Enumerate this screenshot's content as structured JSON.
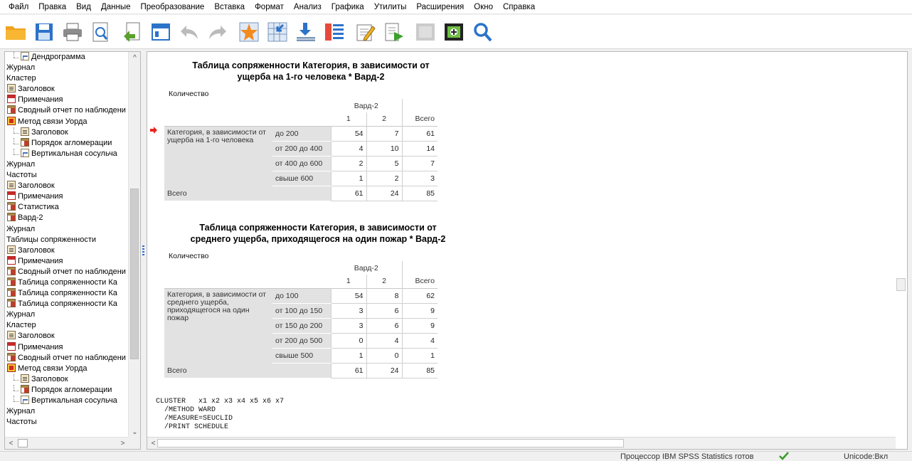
{
  "menu": [
    "Файл",
    "Правка",
    "Вид",
    "Данные",
    "Преобразование",
    "Вставка",
    "Формат",
    "Анализ",
    "Графика",
    "Утилиты",
    "Расширения",
    "Окно",
    "Справка"
  ],
  "toolbar": [
    {
      "name": "open-folder-icon",
      "enabled": true
    },
    {
      "name": "save-icon",
      "enabled": true
    },
    {
      "name": "print-icon",
      "enabled": true
    },
    {
      "name": "print-preview-icon",
      "enabled": true
    },
    {
      "name": "export-icon",
      "enabled": true
    },
    {
      "name": "recall-dialog-icon",
      "enabled": true
    },
    {
      "name": "undo-icon",
      "enabled": false
    },
    {
      "name": "redo-icon",
      "enabled": false
    },
    {
      "name": "goto-case-icon",
      "enabled": true
    },
    {
      "name": "goto-variable-icon",
      "enabled": true
    },
    {
      "name": "insert-output-icon",
      "enabled": true
    },
    {
      "name": "variables-icon",
      "enabled": true
    },
    {
      "name": "edit-icon",
      "enabled": true
    },
    {
      "name": "run-icon",
      "enabled": true
    },
    {
      "name": "hide-icon",
      "enabled": false
    },
    {
      "name": "show-all-icon",
      "enabled": true
    },
    {
      "name": "search-icon",
      "enabled": true
    }
  ],
  "nav_tree": [
    {
      "label": "Дендрограмма",
      "icon": "chart",
      "level": 2
    },
    {
      "label": "Журнал",
      "icon": "",
      "level": 0
    },
    {
      "label": "Кластер",
      "icon": "",
      "level": 0
    },
    {
      "label": "Заголовок",
      "icon": "title",
      "level": 1
    },
    {
      "label": "Примечания",
      "icon": "notes",
      "level": 1
    },
    {
      "label": "Сводный отчет по наблюдени",
      "icon": "table",
      "level": 1
    },
    {
      "label": "Метод связи Уорда",
      "icon": "method",
      "level": 1
    },
    {
      "label": "Заголовок",
      "icon": "title",
      "level": 2
    },
    {
      "label": "Порядок агломерации",
      "icon": "table",
      "level": 2
    },
    {
      "label": "Вертикальная сосульча",
      "icon": "chart",
      "level": 2
    },
    {
      "label": "Журнал",
      "icon": "",
      "level": 0
    },
    {
      "label": "Частоты",
      "icon": "",
      "level": 0
    },
    {
      "label": "Заголовок",
      "icon": "title",
      "level": 1
    },
    {
      "label": "Примечания",
      "icon": "notes",
      "level": 1
    },
    {
      "label": "Статистика",
      "icon": "table",
      "level": 1
    },
    {
      "label": "Вард-2",
      "icon": "table",
      "level": 1
    },
    {
      "label": "Журнал",
      "icon": "",
      "level": 0
    },
    {
      "label": "Таблицы сопряженности",
      "icon": "",
      "level": 0
    },
    {
      "label": "Заголовок",
      "icon": "title",
      "level": 1
    },
    {
      "label": "Примечания",
      "icon": "notes",
      "level": 1
    },
    {
      "label": "Сводный отчет по наблюдени",
      "icon": "table",
      "level": 1
    },
    {
      "label": "Таблица сопряженности Ка",
      "icon": "table",
      "level": 1
    },
    {
      "label": "Таблица сопряженности Ка",
      "icon": "table",
      "level": 1
    },
    {
      "label": "Таблица сопряженности Ка",
      "icon": "table",
      "level": 1
    },
    {
      "label": "Журнал",
      "icon": "",
      "level": 0
    },
    {
      "label": "Кластер",
      "icon": "",
      "level": 0
    },
    {
      "label": "Заголовок",
      "icon": "title",
      "level": 1
    },
    {
      "label": "Примечания",
      "icon": "notes",
      "level": 1
    },
    {
      "label": "Сводный отчет по наблюдени",
      "icon": "table",
      "level": 1
    },
    {
      "label": "Метод связи Уорда",
      "icon": "method",
      "level": 1
    },
    {
      "label": "Заголовок",
      "icon": "title",
      "level": 2
    },
    {
      "label": "Порядок агломерации",
      "icon": "table",
      "level": 2
    },
    {
      "label": "Вертикальная сосульча",
      "icon": "chart",
      "level": 2
    },
    {
      "label": "Журнал",
      "icon": "",
      "level": 0
    },
    {
      "label": "Частоты",
      "icon": "",
      "level": 0
    }
  ],
  "tables": [
    {
      "title_line1": "Таблица сопряженности Категория, в зависимости от",
      "title_line2": "ущерба на 1-го человека * Вард-2",
      "subtitle": "Количество",
      "col_group": "Вард-2",
      "col_headers": [
        "1",
        "2",
        "Всего"
      ],
      "row_label": "Категория, в зависимости от ущерба на 1-го человека",
      "rows": [
        {
          "label": "до 200",
          "values": [
            "54",
            "7",
            "61"
          ]
        },
        {
          "label": "от 200 до 400",
          "values": [
            "4",
            "10",
            "14"
          ]
        },
        {
          "label": "от 400 до 600",
          "values": [
            "2",
            "5",
            "7"
          ]
        },
        {
          "label": "свыше 600",
          "values": [
            "1",
            "2",
            "3"
          ]
        }
      ],
      "total": {
        "label": "Всего",
        "values": [
          "61",
          "24",
          "85"
        ]
      }
    },
    {
      "title_line1": "Таблица сопряженности Категория, в зависимости от",
      "title_line2": "среднего ущерба, приходящегося на один пожар * Вард-2",
      "subtitle": "Количество",
      "col_group": "Вард-2",
      "col_headers": [
        "1",
        "2",
        "Всего"
      ],
      "row_label": "Категория, в зависимости от среднего ущерба, приходящегося на один пожар",
      "rows": [
        {
          "label": "до 100",
          "values": [
            "54",
            "8",
            "62"
          ]
        },
        {
          "label": "от 100 до 150",
          "values": [
            "3",
            "6",
            "9"
          ]
        },
        {
          "label": "от 150 до 200",
          "values": [
            "3",
            "6",
            "9"
          ]
        },
        {
          "label": "от 200 до 500",
          "values": [
            "0",
            "4",
            "4"
          ]
        },
        {
          "label": "свыше 500",
          "values": [
            "1",
            "0",
            "1"
          ]
        }
      ],
      "total": {
        "label": "Всего",
        "values": [
          "61",
          "24",
          "85"
        ]
      }
    }
  ],
  "syntax_lines": [
    "CLUSTER   x1 x2 x3 x4 x5 x6 x7",
    "  /METHOD WARD",
    "  /MEASURE=SEUCLID",
    "  /PRINT SCHEDULE"
  ],
  "status": {
    "processor": "Процессор IBM SPSS Statistics  готов",
    "encoding": "Unicode:Вкл"
  },
  "colors": {
    "accent": "#2f6fd0",
    "cell_shade": "#e2e2e2",
    "arrow": "#e8251c"
  }
}
